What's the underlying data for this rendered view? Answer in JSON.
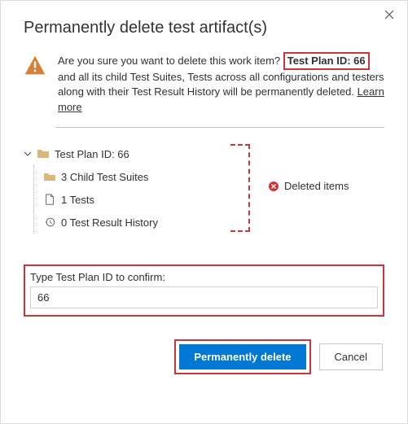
{
  "dialog": {
    "title": "Permanently delete test artifact(s)",
    "warning": {
      "prefix": "Are you sure you want to delete this work item?",
      "highlight": "Test Plan ID: 66",
      "suffix": "and all its child Test Suites, Tests across all configurations and testers along with their Test Result History will be permanently deleted.",
      "learn_more": "Learn more"
    },
    "tree": {
      "root_label": "Test Plan ID: 66",
      "children": [
        {
          "label": "3 Child Test Suites"
        },
        {
          "label": "1 Tests"
        },
        {
          "label": "0 Test Result History"
        }
      ]
    },
    "deleted_badge": "Deleted items",
    "confirm": {
      "label": "Type Test Plan ID to confirm:",
      "value": "66"
    },
    "buttons": {
      "primary": "Permanently delete",
      "secondary": "Cancel"
    }
  }
}
